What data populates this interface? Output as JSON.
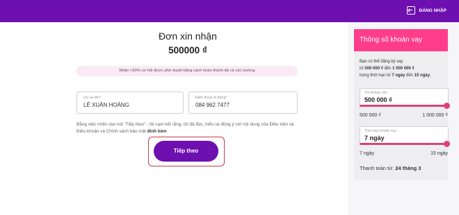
{
  "header": {
    "login_label": "ĐĂNG NHẬP",
    "bg_color": "#6e0fb0",
    "icon": "login-icon"
  },
  "form": {
    "title": "Đơn xin nhận",
    "amount": "500000 ₫",
    "notice": "Nhận +50% cơ hội được phê duyệt bằng cách hoàn thành tất cả các trường",
    "name_label": "Họ và tên*",
    "name_value": "LÊ XUÂN HOÀNG",
    "phone_label": "Điện thoại di động*",
    "phone_value": "084 962 7477",
    "consent_prefix": "Bằng việc nhấn vào nút \"Tiếp theo\" , tôi cam kết rằng, tôi đã đọc, hiểu và đồng ý với nội dung của ",
    "consent_link1": "Điều kiện và Điều khoản",
    "consent_mid": " và ",
    "consent_link2": "Chính sách bảo mật",
    "consent_suffix": " đính kèm",
    "next_button": "Tiếp theo"
  },
  "panel": {
    "title": "Thông số khoản vay",
    "accent_color": "#ff3d8b",
    "desc_1": "Bạn có thể đăng ký vay",
    "desc_2a": "từ ",
    "desc_2b": "500 000 ₫",
    "desc_2c": " đến ",
    "desc_2d": "1 000 000 ₫",
    "desc_3a": "trong thời hạn từ ",
    "desc_3b": "7 ngày",
    "desc_3c": " đến ",
    "desc_3d": "15 ngày",
    "desc_3e": ".",
    "amount_label": "Tôi không cần",
    "amount_value": "500 000 ₫",
    "amount_level": 1.0,
    "amount_min": "500 000 ₫",
    "amount_max": "1 000 000 ₫",
    "term_label": "Thời hạn khoản vay",
    "term_value": "7 ngày",
    "term_level": 1.0,
    "term_min": "7 ngày",
    "term_max": "15 ngày",
    "total_label": "Thanh toán từ: ",
    "total_value": "24 tháng 3"
  }
}
